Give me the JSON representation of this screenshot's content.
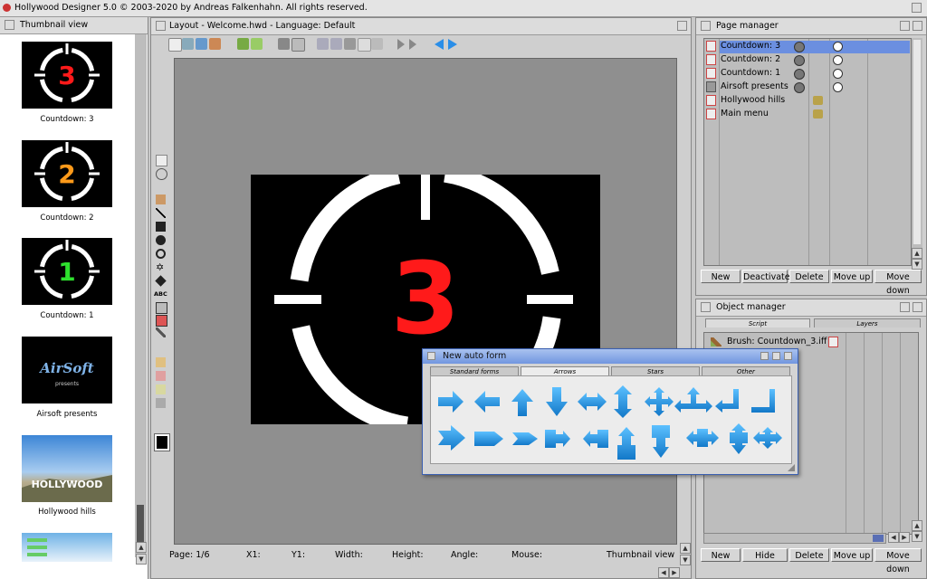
{
  "app": {
    "title": "Hollywood Designer 5.0 © 2003-2020 by Andreas Falkenhahn. All rights reserved."
  },
  "thumbnail_view": {
    "title": "Thumbnail view",
    "items": [
      {
        "caption": "Countdown: 3",
        "digit": "3",
        "digit_color": "#ff1a1a"
      },
      {
        "caption": "Countdown: 2",
        "digit": "2",
        "digit_color": "#ff9a1a"
      },
      {
        "caption": "Countdown: 1",
        "digit": "1",
        "digit_color": "#2ee02e"
      },
      {
        "caption": "Airsoft presents",
        "logo": "AirSoft",
        "logo_sub": "presents"
      },
      {
        "caption": "Hollywood hills",
        "logo": "HOLLYWOOD"
      }
    ]
  },
  "layout": {
    "title": "Layout - Welcome.hwd - Language: Default",
    "slide_digit": "3",
    "slide_digit_color": "#ff1a1a",
    "status": {
      "page": "Page:  1/6",
      "x1": "X1:",
      "y1": "Y1:",
      "width": "Width:",
      "height": "Height:",
      "angle": "Angle:",
      "mouse": "Mouse:",
      "view": "Thumbnail view"
    },
    "tool_label": "ABC"
  },
  "page_manager": {
    "title": "Page manager",
    "pages": [
      {
        "name": "Countdown: 3",
        "selected": true
      },
      {
        "name": "Countdown: 2",
        "selected": false
      },
      {
        "name": "Countdown: 1",
        "selected": false
      },
      {
        "name": "Airsoft presents",
        "selected": false
      },
      {
        "name": "Hollywood hills",
        "selected": false
      },
      {
        "name": "Main menu",
        "selected": false
      }
    ],
    "buttons": {
      "new": "New",
      "deactivate": "Deactivate",
      "delete": "Delete",
      "move_up": "Move up",
      "move_down": "Move down"
    }
  },
  "object_manager": {
    "title": "Object manager",
    "tabs": {
      "script": "Script",
      "layers": "Layers"
    },
    "objects": [
      {
        "name": "Brush: Countdown_3.iff"
      }
    ],
    "buttons": {
      "new": "New",
      "hide": "Hide",
      "delete": "Delete",
      "move_up": "Move up",
      "move_down": "Move down"
    }
  },
  "auto_form": {
    "title": "New auto form",
    "tabs": {
      "standard": "Standard forms",
      "arrows": "Arrows",
      "stars": "Stars",
      "other": "Other"
    },
    "active_tab": "Arrows",
    "accent": "#1e9bf0"
  }
}
